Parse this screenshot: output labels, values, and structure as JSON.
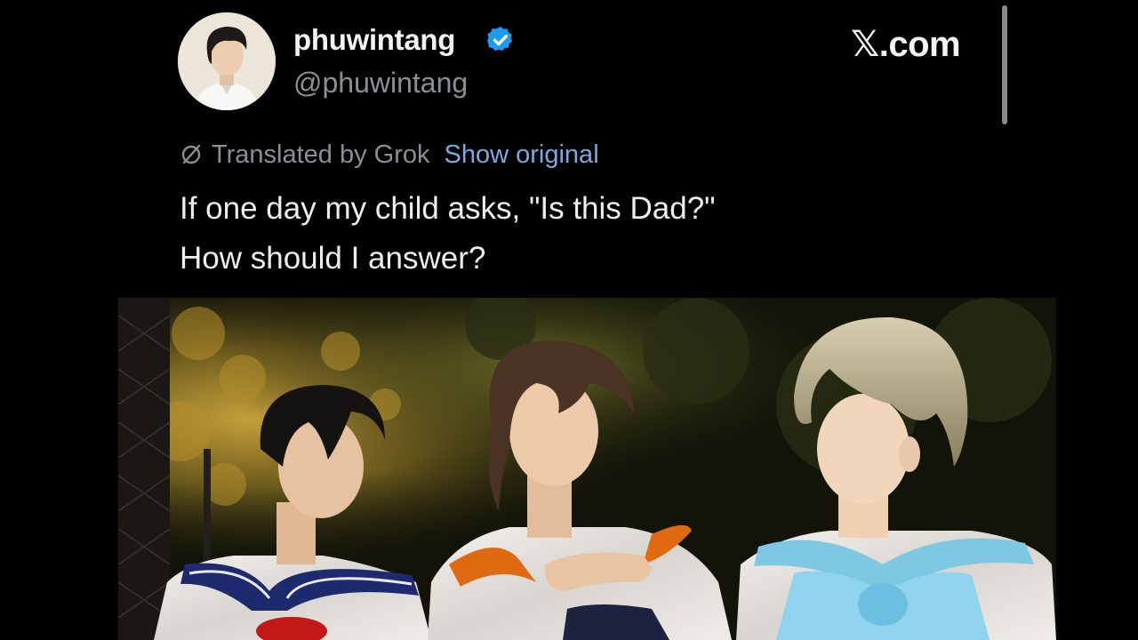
{
  "author": {
    "display_name": "phuwintang",
    "handle": "@phuwintang",
    "avatar_icon": "profile-photo",
    "verified_icon": "verified-badge-icon",
    "verified_color": "#1d9bf0"
  },
  "site": {
    "label_glyph": "𝕏",
    "label_text": ".com"
  },
  "translation": {
    "icon": "grok-icon",
    "label": "Translated by Grok",
    "show_original": "Show original",
    "link_color": "#7fa7e0"
  },
  "tweet": {
    "lines": [
      "If one day my child asks, \"Is this Dad?\"",
      "How should I answer?"
    ]
  },
  "media": {
    "description_icon": "tweet-photo"
  }
}
